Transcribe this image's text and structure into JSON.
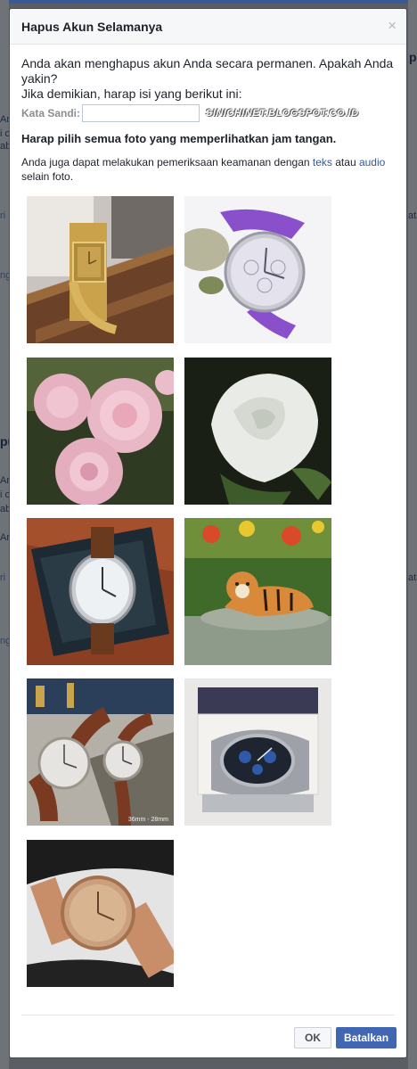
{
  "dialog": {
    "title": "Hapus Akun Selamanya",
    "close_symbol": "×",
    "intro_line1": "Anda akan menghapus akun Anda secara permanen. Apakah Anda yakin?",
    "intro_line2": "Jika demikian, harap isi yang berikut ini:",
    "password_label": "Kata Sandi:",
    "password_value": "",
    "watermark": "SINICHINET.BLOGSPOT.CO.ID",
    "instruction": "Harap pilih semua foto yang memperlihatkan jam tangan.",
    "alt_prefix": "Anda juga dapat melakukan pemeriksaan keamanan dengan ",
    "alt_link_text": "teks",
    "alt_middle": " atau ",
    "alt_link_audio": "audio",
    "alt_suffix": " selain foto.",
    "ok_label": "OK",
    "cancel_label": "Batalkan"
  },
  "photos": [
    {
      "name": "gold-square-watch-photo",
      "subject": "watch"
    },
    {
      "name": "purple-strap-watch-photo",
      "subject": "watch"
    },
    {
      "name": "pink-roses-photo",
      "subject": "flower"
    },
    {
      "name": "white-rose-photo",
      "subject": "flower"
    },
    {
      "name": "watch-in-box-photo",
      "subject": "watch"
    },
    {
      "name": "tiger-photo",
      "subject": "animal"
    },
    {
      "name": "couple-watches-photo",
      "subject": "watch",
      "caption": "36mm - 28mm"
    },
    {
      "name": "chronograph-watch-photo",
      "subject": "watch"
    },
    {
      "name": "rose-gold-watch-photo",
      "subject": "watch"
    }
  ],
  "background_page": {
    "fragments": [
      "pu",
      "Ar",
      "i c",
      "aba",
      "ata",
      "ngg",
      "ri",
      "An",
      "pu",
      "Ar",
      "i c",
      "aba",
      "ri",
      "ata",
      "ngg"
    ]
  },
  "colors": {
    "header_bg": "#f6f7f9",
    "link": "#365899",
    "primary_button": "#4267b2",
    "overlay": "#5b5e63"
  }
}
